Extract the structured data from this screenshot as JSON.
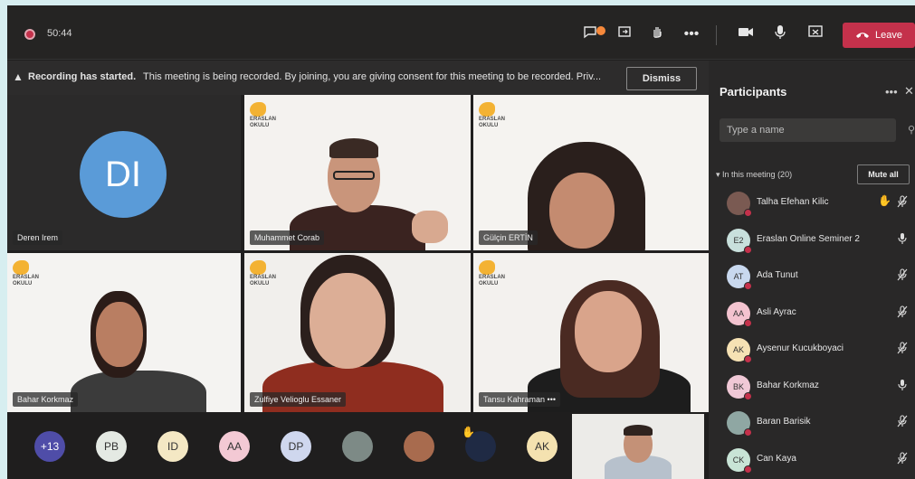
{
  "topbar": {
    "timer": "50:44",
    "leave_label": "Leave",
    "icons": [
      "chat-icon",
      "share-tray-icon",
      "raise-hand-icon",
      "more-icon",
      "camera-icon",
      "mic-icon",
      "share-screen-icon"
    ]
  },
  "banner": {
    "bold": "Recording has started.",
    "message": "This meeting is being recorded. By joining, you are giving consent for this meeting to be recorded. Priv...",
    "dismiss_label": "Dismiss"
  },
  "tiles": [
    {
      "name": "Deren Irem",
      "initials": "DI"
    },
    {
      "name": "Muhammet Corab",
      "logo": "ERASLAN OKULU"
    },
    {
      "name": "Gülçin ERTİN",
      "logo": "ERASLAN OKULU"
    },
    {
      "name": "Bahar Korkmaz",
      "logo": "ERASLAN OKULU"
    },
    {
      "name": "Zulfiye Velioglu Essaner",
      "logo": "ERASLAN OKULU"
    },
    {
      "name": "Tansu Kahraman",
      "logo": "ERASLAN OKULU"
    }
  ],
  "strip": {
    "chips": [
      "+13",
      "PB",
      "ID",
      "AA",
      "DP",
      "",
      "",
      "",
      "AK"
    ]
  },
  "participants": {
    "title": "Participants",
    "search_placeholder": "Type a name",
    "section": "In this meeting (20)",
    "mute_all": "Mute all",
    "list": [
      {
        "name": "Talha Efehan Kilic",
        "initials": "",
        "color": "#7a5a52",
        "hand": true,
        "mic": "muted"
      },
      {
        "name": "Eraslan Online Seminer 2",
        "initials": "E2",
        "color": "#c8e0dc",
        "hand": false,
        "mic": "on"
      },
      {
        "name": "Ada Tunut",
        "initials": "AT",
        "color": "#c8d8ee",
        "hand": false,
        "mic": "muted"
      },
      {
        "name": "Asli Ayrac",
        "initials": "AA",
        "color": "#f3c3cf",
        "hand": false,
        "mic": "muted"
      },
      {
        "name": "Aysenur Kucukboyaci",
        "initials": "AK",
        "color": "#f6e2b4",
        "hand": false,
        "mic": "muted"
      },
      {
        "name": "Bahar Korkmaz",
        "initials": "BK",
        "color": "#f0c8d6",
        "hand": false,
        "mic": "on"
      },
      {
        "name": "Baran Barisik",
        "initials": "",
        "color": "#8fa7a3",
        "hand": false,
        "mic": "muted"
      },
      {
        "name": "Can Kaya",
        "initials": "CK",
        "color": "#c8e4d6",
        "hand": false,
        "mic": "muted"
      }
    ]
  }
}
